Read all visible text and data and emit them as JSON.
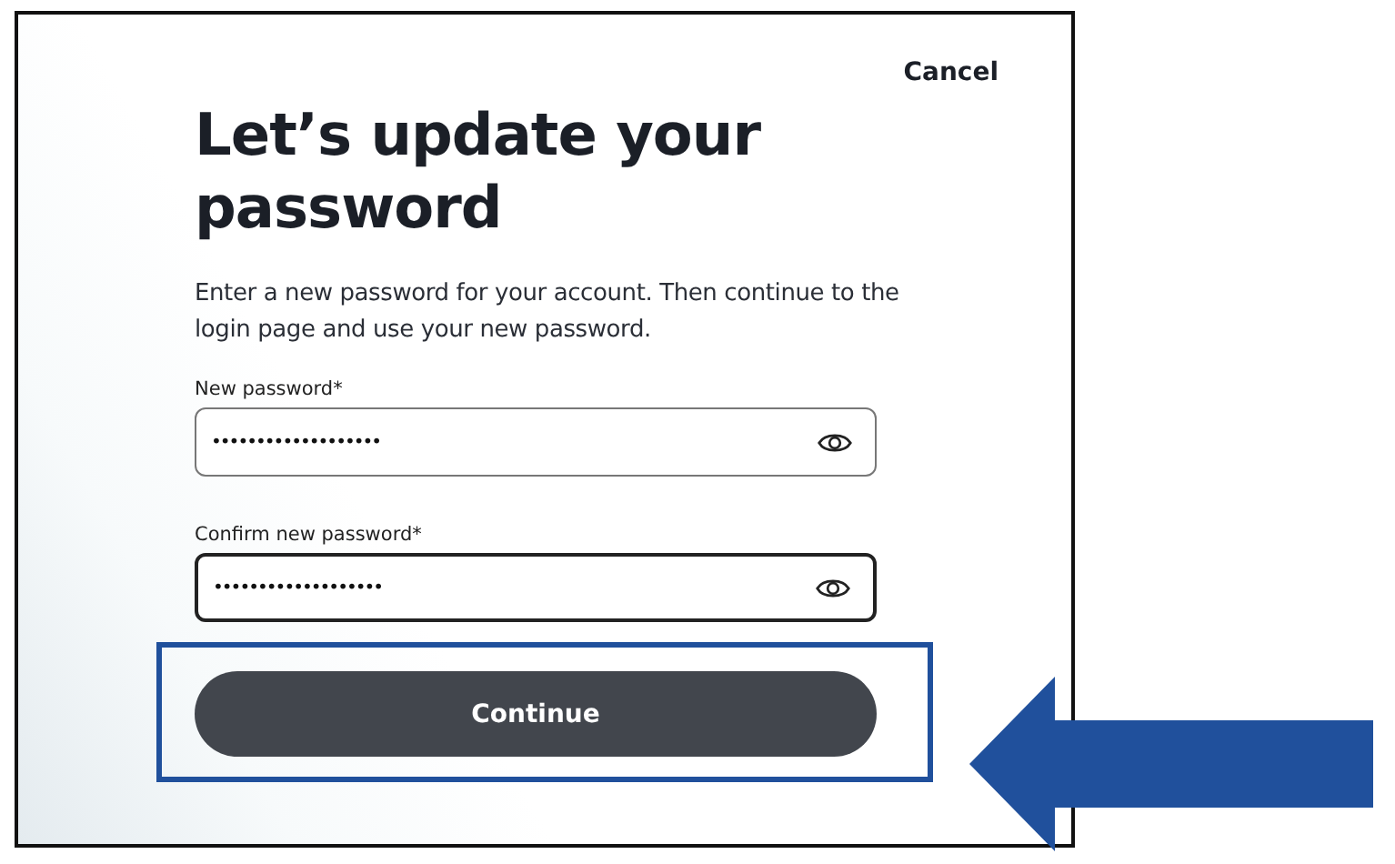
{
  "cancel": "Cancel",
  "heading": "Let’s update your password",
  "description": "Enter a new password for your account. Then continue to the login page and use your new password.",
  "fields": [
    {
      "label": "New password*",
      "value": "•••••••••••••••••••",
      "focused": false
    },
    {
      "label": "Confirm new password*",
      "value": "•••••••••••••••••••",
      "focused": true
    }
  ],
  "submit": {
    "label": "Continue",
    "highlighted": true
  },
  "pointer_arrow": true
}
